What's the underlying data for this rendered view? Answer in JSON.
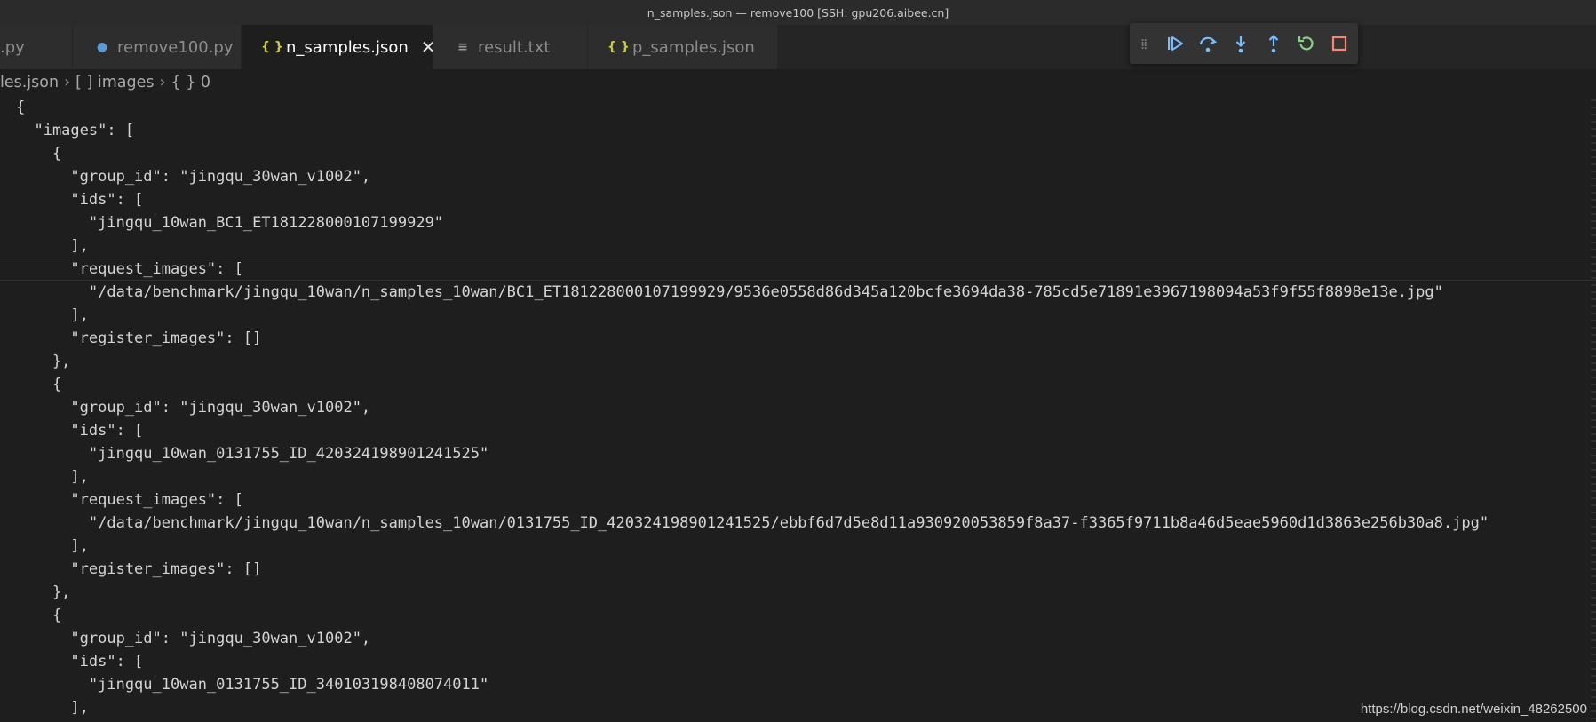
{
  "window": {
    "title": "n_samples.json — remove100 [SSH: gpu206.aibee.cn]"
  },
  "tabs": [
    {
      "label": ".py",
      "icon": "python-icon"
    },
    {
      "label": "remove100.py",
      "icon": "python-icon"
    },
    {
      "label": "n_samples.json",
      "icon": "json-braces-icon"
    },
    {
      "label": "result.txt",
      "icon": "text-file-icon"
    },
    {
      "label": "p_samples.json",
      "icon": "json-braces-icon"
    }
  ],
  "breadcrumb": {
    "file": "les.json",
    "segment1": "[ ] images",
    "segment2": "{ } 0"
  },
  "debug_toolbar": {
    "buttons": [
      "continue",
      "step-over",
      "step-into",
      "step-out",
      "restart",
      "stop"
    ],
    "colors": {
      "blue": "#75beff",
      "green": "#89d185",
      "red": "#f48771"
    }
  },
  "editor": {
    "lines": [
      "{",
      "  \"images\": [",
      "    {",
      "      \"group_id\": \"jingqu_30wan_v1002\",",
      "      \"ids\": [",
      "        \"jingqu_10wan_BC1_ET181228000107199929\"",
      "      ],",
      "      \"request_images\": [",
      "        \"/data/benchmark/jingqu_10wan/n_samples_10wan/BC1_ET181228000107199929/9536e0558d86d345a120bcfe3694da38-785cd5e71891e3967198094a53f9f55f8898e13e.jpg\"",
      "      ],",
      "      \"register_images\": []",
      "    },",
      "    {",
      "      \"group_id\": \"jingqu_30wan_v1002\",",
      "      \"ids\": [",
      "        \"jingqu_10wan_0131755_ID_420324198901241525\"",
      "      ],",
      "      \"request_images\": [",
      "        \"/data/benchmark/jingqu_10wan/n_samples_10wan/0131755_ID_420324198901241525/ebbf6d7d5e8d11a930920053859f8a37-f3365f9711b8a46d5eae5960d1d3863e256b30a8.jpg\"",
      "      ],",
      "      \"register_images\": []",
      "    },",
      "    {",
      "      \"group_id\": \"jingqu_30wan_v1002\",",
      "      \"ids\": [",
      "        \"jingqu_10wan_0131755_ID_340103198408074011\"",
      "      ],"
    ]
  },
  "watermark": "https://blog.csdn.net/weixin_48262500"
}
